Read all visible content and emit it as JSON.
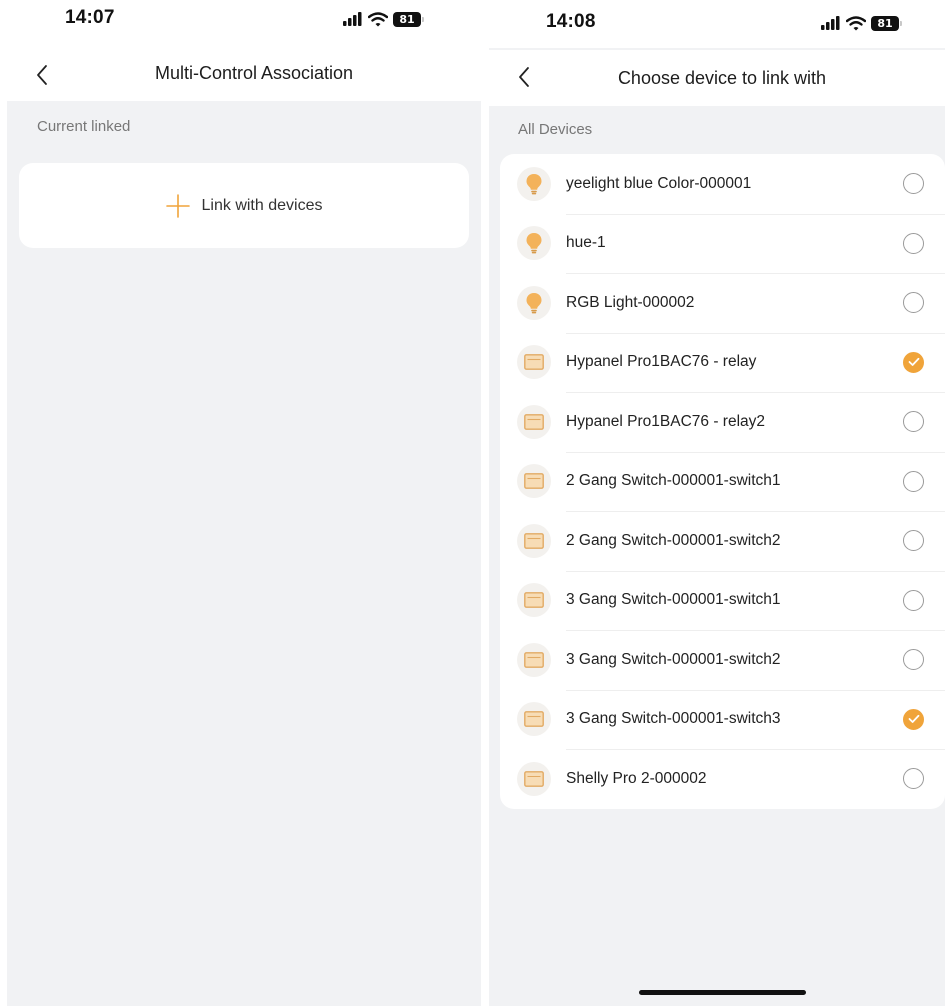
{
  "colors": {
    "accent": "#f0a43a",
    "page_background": "#f1f2f4",
    "card_background": "#ffffff",
    "muted_text": "#777777"
  },
  "left_screen": {
    "status": {
      "time": "14:07",
      "battery": "81"
    },
    "nav": {
      "title": "Multi-Control Association",
      "back_icon": "chevron-left-icon"
    },
    "section_label": "Current linked",
    "link_button": {
      "icon": "plus-icon",
      "label": "Link with devices"
    }
  },
  "right_screen": {
    "status": {
      "time": "14:08",
      "battery": "81"
    },
    "nav": {
      "title": "Choose device to link with",
      "back_icon": "chevron-left-icon"
    },
    "section_label": "All Devices",
    "devices": [
      {
        "name": "yeelight blue Color-000001",
        "icon": "bulb-icon",
        "checked": false
      },
      {
        "name": "hue-1",
        "icon": "bulb-icon",
        "checked": false
      },
      {
        "name": "RGB Light-000002",
        "icon": "bulb-icon",
        "checked": false
      },
      {
        "name": "Hypanel Pro1BAC76 - relay",
        "icon": "switch-panel-icon",
        "checked": true
      },
      {
        "name": "Hypanel Pro1BAC76 - relay2",
        "icon": "switch-panel-icon",
        "checked": false
      },
      {
        "name": "2 Gang Switch-000001-switch1",
        "icon": "switch-panel-icon",
        "checked": false
      },
      {
        "name": "2 Gang Switch-000001-switch2",
        "icon": "switch-panel-icon",
        "checked": false
      },
      {
        "name": "3 Gang Switch-000001-switch1",
        "icon": "switch-panel-icon",
        "checked": false
      },
      {
        "name": "3 Gang Switch-000001-switch2",
        "icon": "switch-panel-icon",
        "checked": false
      },
      {
        "name": "3 Gang Switch-000001-switch3",
        "icon": "switch-panel-icon",
        "checked": true
      },
      {
        "name": "Shelly Pro 2-000002",
        "icon": "switch-panel-icon",
        "checked": false
      }
    ]
  }
}
